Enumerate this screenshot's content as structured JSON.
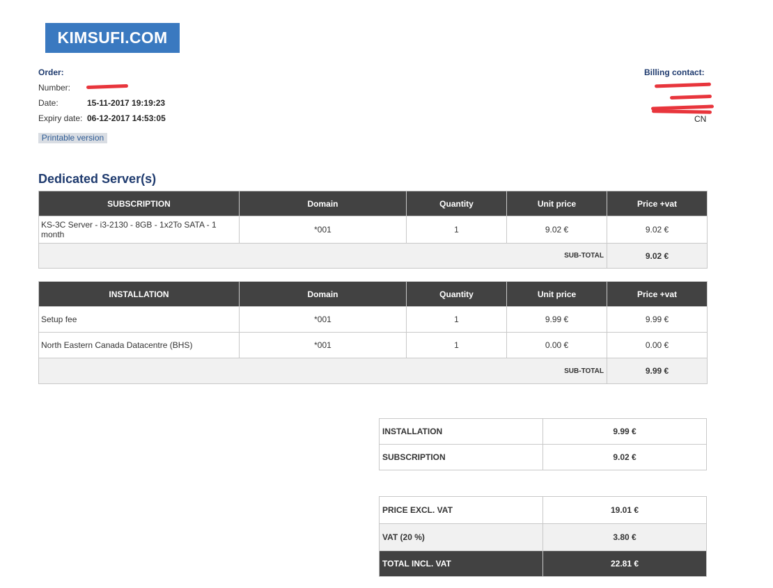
{
  "header": {
    "logo": "KIMSUFI.COM"
  },
  "order": {
    "title": "Order:",
    "number_label": "Number:",
    "date_label": "Date:",
    "date": "15-11-2017 19:19:23",
    "expiry_label": "Expiry date:",
    "expiry": "06-12-2017 14:53:05",
    "printable": "Printable version"
  },
  "billing": {
    "title": "Billing contact:",
    "country": "CN"
  },
  "section_title": "Dedicated Server(s)",
  "subscription": {
    "headers": [
      "SUBSCRIPTION",
      "Domain",
      "Quantity",
      "Unit price",
      "Price +vat"
    ],
    "rows": [
      {
        "desc": "KS-3C Server - i3-2130 - 8GB - 1x2To SATA - 1 month",
        "domain": "*001",
        "qty": "1",
        "unit": "9.02 €",
        "price": "9.02 €"
      }
    ],
    "subtotal_label": "SUB-TOTAL",
    "subtotal": "9.02 €"
  },
  "installation": {
    "headers": [
      "INSTALLATION",
      "Domain",
      "Quantity",
      "Unit price",
      "Price +vat"
    ],
    "rows": [
      {
        "desc": "Setup fee",
        "domain": "*001",
        "qty": "1",
        "unit": "9.99 €",
        "price": "9.99 €"
      },
      {
        "desc": "North Eastern Canada Datacentre (BHS)",
        "domain": "*001",
        "qty": "1",
        "unit": "0.00 €",
        "price": "0.00 €"
      }
    ],
    "subtotal_label": "SUB-TOTAL",
    "subtotal": "9.99 €"
  },
  "summary": [
    {
      "label": "INSTALLATION",
      "value": "9.99 €"
    },
    {
      "label": "SUBSCRIPTION",
      "value": "9.02 €"
    }
  ],
  "totals": [
    {
      "label": "PRICE EXCL. VAT",
      "value": "19.01 €"
    },
    {
      "label": "VAT (20 %)",
      "value": "3.80 €"
    },
    {
      "label": "TOTAL INCL. VAT",
      "value": "22.81 €"
    }
  ],
  "colors": {
    "brand": "#3a79c0",
    "heading": "#1e3a6e",
    "table_header": "#424242",
    "redaction": "#e8353c"
  }
}
